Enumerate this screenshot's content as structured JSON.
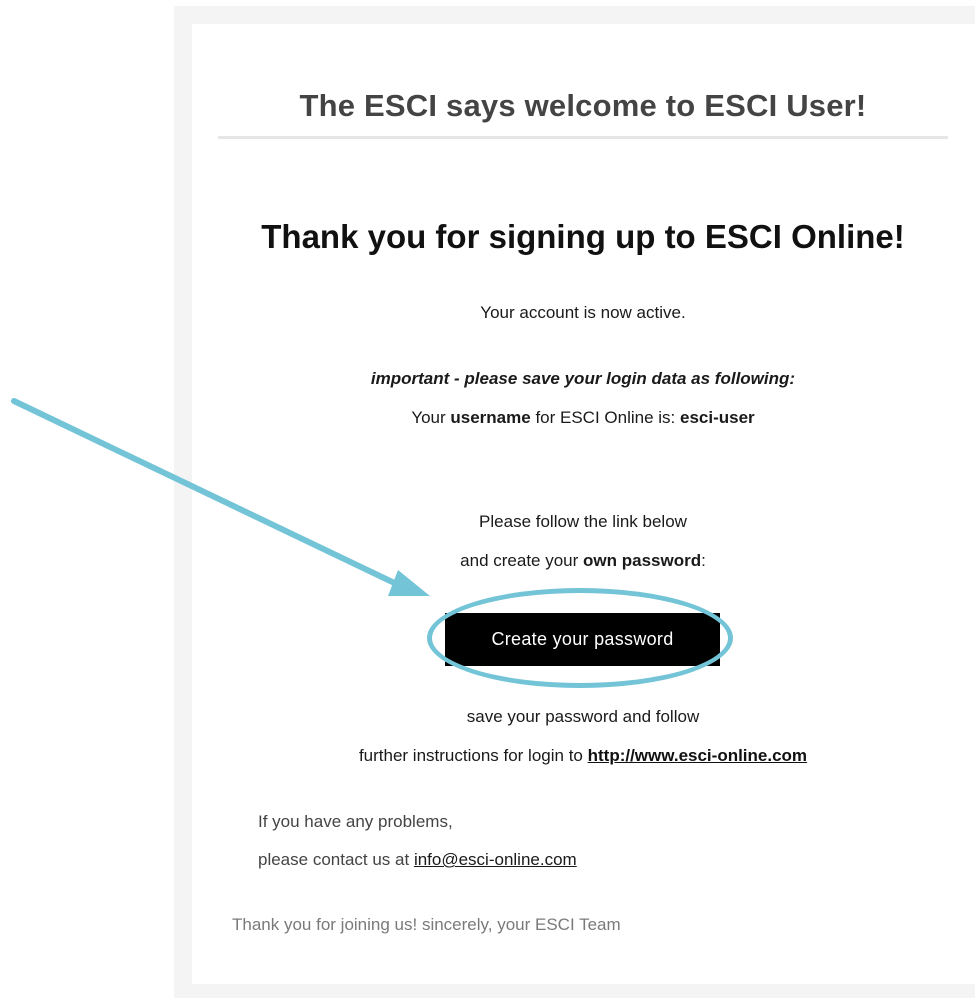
{
  "email": {
    "header_title": "The ESCI says welcome to ESCI User!",
    "thank_title": "Thank you for signing up to ESCI Online!",
    "account_active": "Your account is now active.",
    "important_note": "important - please save your login data as following:",
    "username_line": {
      "prefix": "Your ",
      "bold_word": "username",
      "middle": " for ESCI Online is: ",
      "username": "esci-user"
    },
    "follow_link_line": "Please follow the link below",
    "create_line": {
      "prefix": "and create your ",
      "bold_word": "own password",
      "suffix": ":"
    },
    "cta_button_label": "Create your password",
    "save_line": "save your password and follow",
    "further_line": {
      "prefix": "further instructions for login to ",
      "link_text": "http://www.esci-online.com"
    },
    "contact": {
      "problems": "If you have any problems,",
      "contact_prefix": "please contact us at ",
      "email": "info@esci-online.com"
    },
    "signoff": "Thank you for joining us! sincerely, your ESCI Team"
  },
  "colors": {
    "annotation": "#73c4d7",
    "button_bg": "#000000",
    "button_text": "#ffffff",
    "rule": "#e6e6e6"
  }
}
